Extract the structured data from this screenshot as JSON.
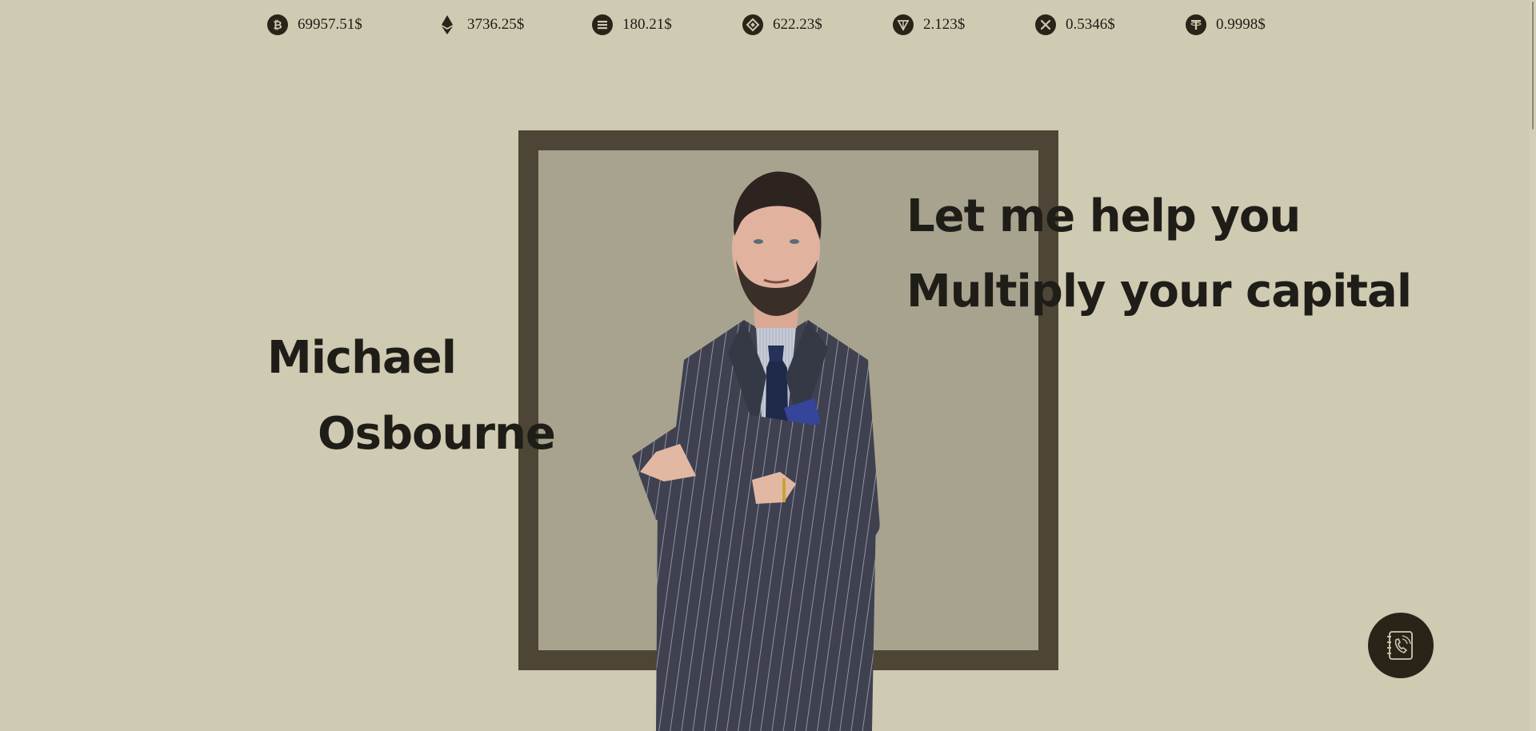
{
  "ticker": [
    {
      "icon": "bitcoin-icon",
      "price": "69957.51$"
    },
    {
      "icon": "ethereum-icon",
      "price": "3736.25$"
    },
    {
      "icon": "solana-icon",
      "price": "180.21$"
    },
    {
      "icon": "bnb-icon",
      "price": "622.23$"
    },
    {
      "icon": "toncoin-icon",
      "price": "2.123$"
    },
    {
      "icon": "xrp-icon",
      "price": "0.5346$"
    },
    {
      "icon": "tether-icon",
      "price": "0.9998$"
    }
  ],
  "hero": {
    "headline_line1": "Let me help you",
    "headline_line2": "Multiply your capital",
    "first_name": "Michael",
    "last_name": "Osbourne"
  },
  "colors": {
    "background": "#cfcab2",
    "frame": "#4d4636",
    "frame_inner": "#a8a38e",
    "text": "#1f1d18",
    "icon_bg": "#2a2318"
  },
  "contact_button": {
    "icon": "phone-book-icon"
  }
}
